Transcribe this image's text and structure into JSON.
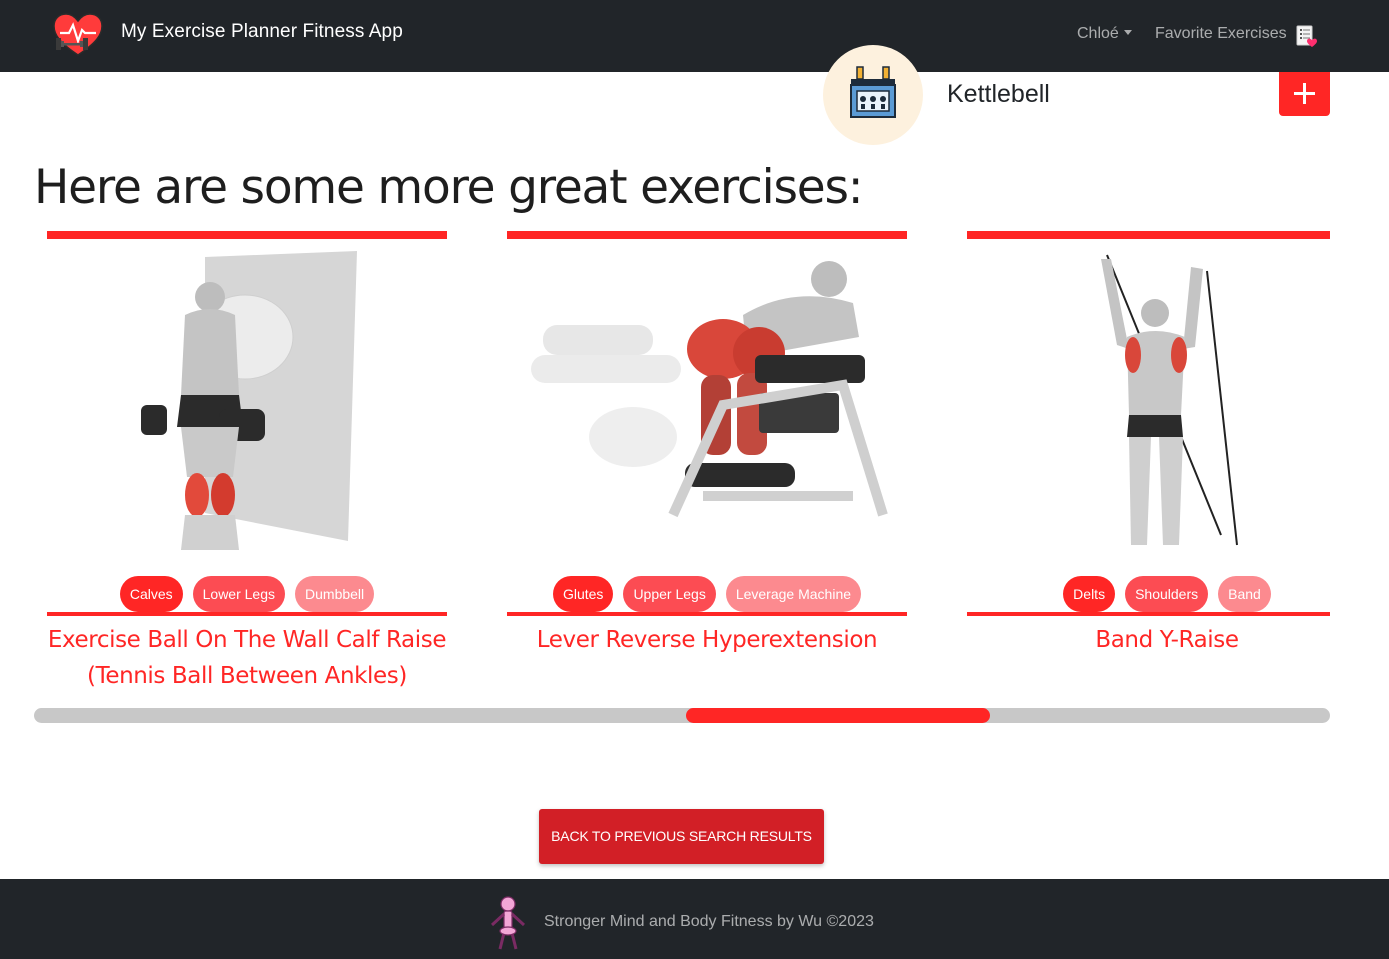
{
  "navbar": {
    "title": "My Exercise Planner Fitness App",
    "user_menu": "Chloé",
    "favorites_link": "Favorite Exercises",
    "logo_icon": "heart-dumbbell-icon",
    "favorites_icon": "clipboard-heart-icon"
  },
  "equipment": {
    "label": "Kettlebell",
    "icon": "gym-equipment-icon",
    "add_icon": "plus-icon"
  },
  "section": {
    "heading": "Here are some more great exercises:"
  },
  "cards": [
    {
      "title": "Exercise Ball On The Wall Calf Raise (Tennis Ball Between Ankles)",
      "tags": [
        "Calves",
        "Lower Legs",
        "Dumbbell"
      ],
      "image": "calf-raise-illustration"
    },
    {
      "title": "Lever Reverse Hyperextension",
      "tags": [
        "Glutes",
        "Upper Legs",
        "Leverage Machine"
      ],
      "image": "reverse-hyperextension-illustration"
    },
    {
      "title": "Band Y-Raise",
      "tags": [
        "Delts",
        "Shoulders",
        "Band"
      ],
      "image": "band-y-raise-illustration"
    }
  ],
  "scrollbar": {
    "thumb_start_fraction": 0.503,
    "thumb_size_fraction": 0.235
  },
  "actions": {
    "back_label": "BACK TO PREVIOUS SEARCH RESULTS"
  },
  "footer": {
    "text": "Stronger Mind and Body Fitness by Wu ©2023",
    "icon": "skeleton-icon"
  },
  "colors": {
    "accent": "#ff2625",
    "navbar_bg": "#212529",
    "tag_secondary": "#fc4c53",
    "tag_tertiary": "#fc8a8f",
    "back_button": "#d21f26"
  }
}
